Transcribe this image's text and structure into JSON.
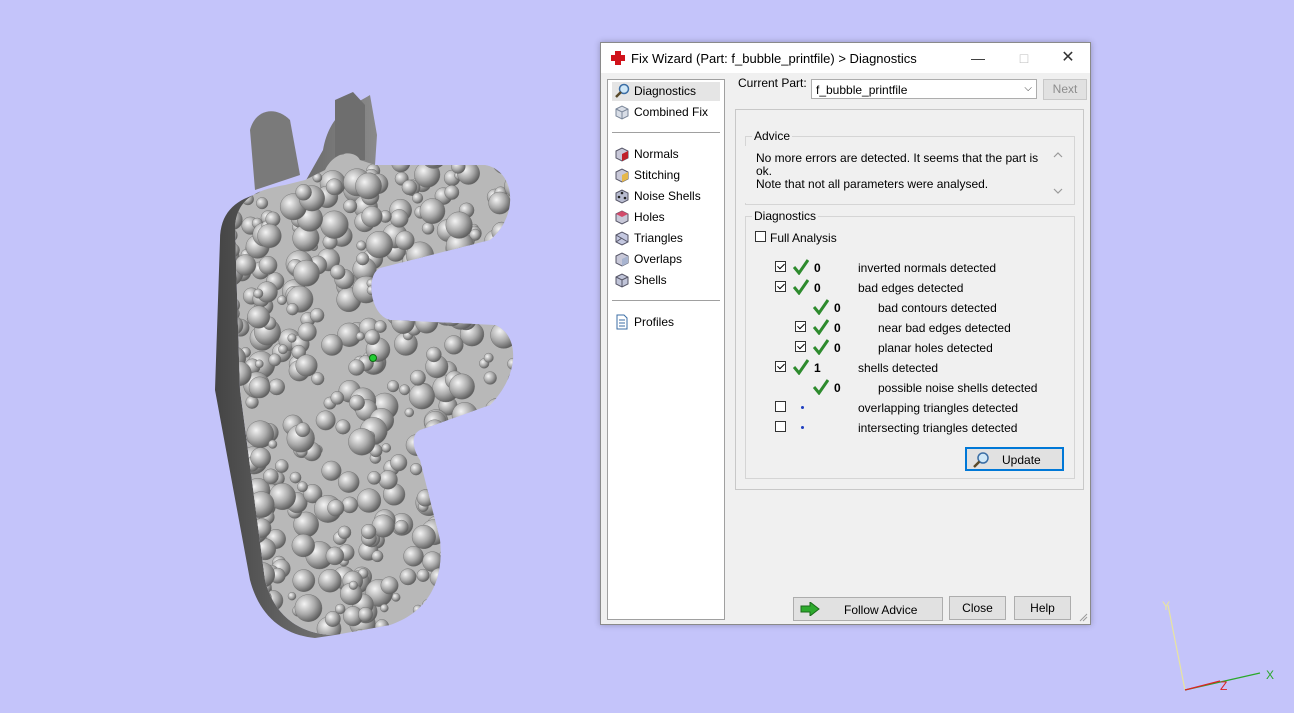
{
  "dialog": {
    "title": "Fix Wizard (Part: f_bubble_printfile) > Diagnostics"
  },
  "nav": {
    "items": [
      {
        "label": "Diagnostics",
        "icon": "magnifier-icon"
      },
      {
        "label": "Combined Fix",
        "icon": "combined-fix-icon"
      },
      {
        "label": "Normals",
        "icon": "normals-cube-icon"
      },
      {
        "label": "Stitching",
        "icon": "stitching-cube-icon"
      },
      {
        "label": "Noise Shells",
        "icon": "noise-shells-cube-icon"
      },
      {
        "label": "Holes",
        "icon": "holes-cube-icon"
      },
      {
        "label": "Triangles",
        "icon": "triangles-cube-icon"
      },
      {
        "label": "Overlaps",
        "icon": "overlaps-cube-icon"
      },
      {
        "label": "Shells",
        "icon": "shells-cube-icon"
      },
      {
        "label": "Profiles",
        "icon": "profiles-document-icon"
      }
    ],
    "active": "Diagnostics"
  },
  "part": {
    "label": "Current Part:",
    "value": "f_bubble_printfile",
    "next_label": "Next"
  },
  "advice": {
    "title": "Advice",
    "line1": "No more errors are detected. It seems that the part is ok.",
    "line2": "Note that not all parameters were analysed."
  },
  "diagnostics": {
    "title": "Diagnostics",
    "full_analysis_label": "Full Analysis",
    "full_analysis_checked": false,
    "rows": [
      {
        "checkbox": true,
        "checked": true,
        "status": "ok",
        "count": "0",
        "label": "inverted normals detected",
        "indent": 0
      },
      {
        "checkbox": true,
        "checked": true,
        "status": "ok",
        "count": "0",
        "label": "bad edges detected",
        "indent": 0
      },
      {
        "checkbox": false,
        "checked": false,
        "status": "ok",
        "count": "0",
        "label": "bad contours detected",
        "indent": 1
      },
      {
        "checkbox": true,
        "checked": true,
        "status": "ok",
        "count": "0",
        "label": "near bad edges detected",
        "indent": 1
      },
      {
        "checkbox": true,
        "checked": true,
        "status": "ok",
        "count": "0",
        "label": "planar holes detected",
        "indent": 1
      },
      {
        "checkbox": true,
        "checked": true,
        "status": "ok",
        "count": "1",
        "label": "shells detected",
        "indent": 0
      },
      {
        "checkbox": false,
        "checked": false,
        "status": "ok",
        "count": "0",
        "label": "possible noise shells detected",
        "indent": 1
      },
      {
        "checkbox": true,
        "checked": false,
        "status": "pending",
        "count": "",
        "label": "overlapping triangles detected",
        "indent": 0
      },
      {
        "checkbox": true,
        "checked": false,
        "status": "pending",
        "count": "",
        "label": "intersecting triangles detected",
        "indent": 0
      }
    ],
    "update_label": "Update"
  },
  "footer": {
    "follow_advice_label": "Follow Advice",
    "close_label": "Close",
    "help_label": "Help"
  },
  "axes": {
    "x": "X",
    "y": "Y",
    "z": "Z"
  },
  "colors": {
    "background": "#c4c4fa",
    "ok_check": "#2e8b2e",
    "focus_blue": "#0078d7",
    "model_gray": "#8c8c8c"
  }
}
